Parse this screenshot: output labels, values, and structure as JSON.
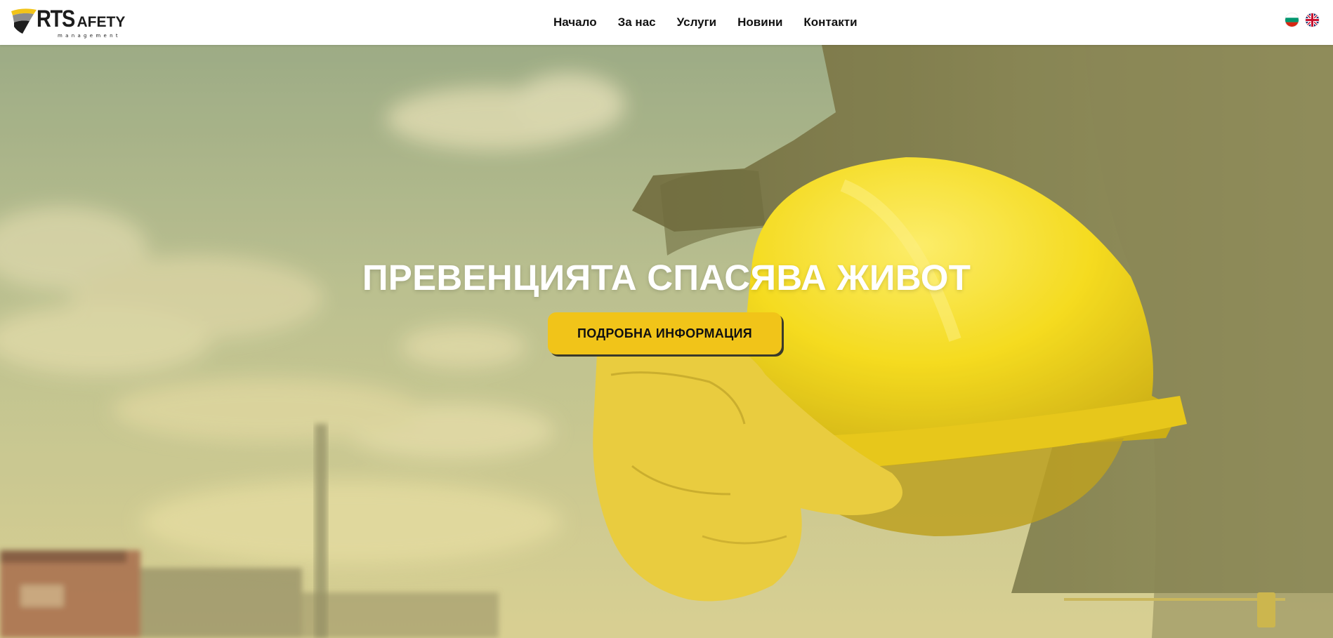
{
  "header": {
    "logo": {
      "main_letters": "RTS",
      "main_rest": "AFETY",
      "tagline": "management",
      "s_letter": "S"
    },
    "nav": [
      {
        "label": "Начало"
      },
      {
        "label": "За нас"
      },
      {
        "label": "Услуги"
      },
      {
        "label": "Новини"
      },
      {
        "label": "Контакти"
      }
    ],
    "languages": [
      {
        "code": "bg",
        "icon": "bulgaria-flag-icon"
      },
      {
        "code": "en",
        "icon": "uk-flag-icon"
      }
    ]
  },
  "hero": {
    "title": "ПРЕВЕНЦИЯТА СПАСЯВА ЖИВОТ",
    "button_label": "ПОДРОБНА ИНФОРМАЦИЯ",
    "background_description_icon": "worker-holding-yellow-hard-hat-image"
  },
  "colors": {
    "accent": "#f1c419",
    "header_bg": "#ffffff",
    "nav_text": "#111111",
    "hero_text": "#ffffff"
  }
}
